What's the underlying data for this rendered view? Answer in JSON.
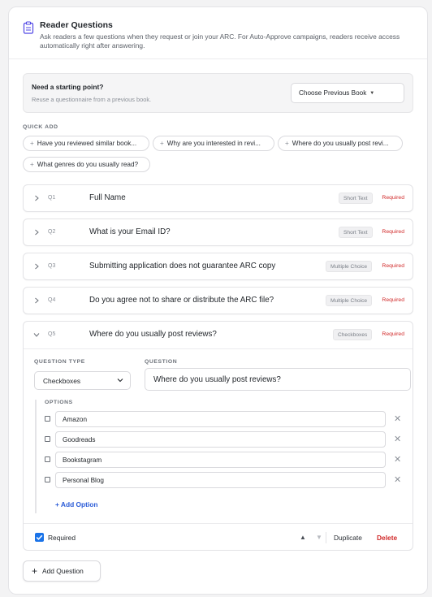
{
  "header": {
    "title": "Reader Questions",
    "description": "Ask readers a few questions when they request or join your ARC. For Auto-Approve campaigns, readers receive access automatically right after answering."
  },
  "starting_point": {
    "title": "Need a starting point?",
    "subtitle": "Reuse a questionnaire from a previous book.",
    "button": "Choose Previous Book"
  },
  "quick_add": {
    "label": "QUICK ADD",
    "chips": [
      "Have you reviewed similar book...",
      "Why are you interested in revi...",
      "Where do you usually post revi...",
      "What genres do you usually read?"
    ]
  },
  "questions": [
    {
      "num": "Q1",
      "title": "Full Name",
      "type": "Short Text",
      "required": "Required"
    },
    {
      "num": "Q2",
      "title": "What is your Email ID?",
      "type": "Short Text",
      "required": "Required"
    },
    {
      "num": "Q3",
      "title": "Submitting application does not guarantee ARC copy",
      "type": "Multiple Choice",
      "required": "Required"
    },
    {
      "num": "Q4",
      "title": "Do you agree not to share or distribute the ARC file?",
      "type": "Multiple Choice",
      "required": "Required"
    }
  ],
  "expanded": {
    "num": "Q5",
    "title": "Where do you usually post reviews?",
    "type": "Checkboxes",
    "required": "Required",
    "question_type_label": "QUESTION TYPE",
    "question_label": "QUESTION",
    "question_type_value": "Checkboxes",
    "question_value": "Where do you usually post reviews?",
    "options_label": "OPTIONS",
    "options": [
      "Amazon",
      "Goodreads",
      "Bookstagram",
      "Personal Blog"
    ],
    "add_option": "+ Add Option",
    "required_label": "Required",
    "duplicate": "Duplicate",
    "delete": "Delete",
    "required_checked": true
  },
  "add_question": "Add Question",
  "colors": {
    "accent": "#1a73e8",
    "danger": "#d12a2a",
    "link": "#2a5bd7"
  }
}
